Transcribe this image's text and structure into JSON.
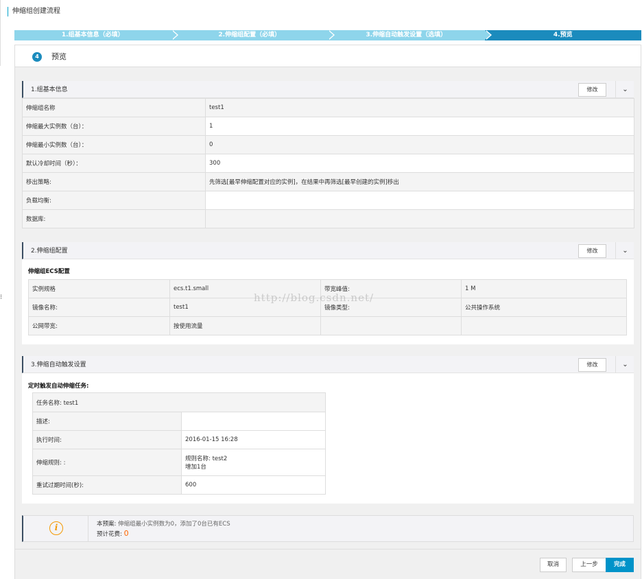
{
  "page": {
    "title": "伸缩组创建流程"
  },
  "steps": [
    "1.组基本信息（必填）",
    "2.伸缩组配置（必填）",
    "3.伸缩自动触发设置（选填）",
    "4.预览"
  ],
  "preview": {
    "number": "4",
    "title": "预览"
  },
  "section1": {
    "title": "1.组基本信息",
    "edit_label": "修改",
    "rows": [
      {
        "label": "伸缩组名称",
        "value": "test1"
      },
      {
        "label": "伸缩最大实例数（台）：",
        "value": "1"
      },
      {
        "label": "伸缩最小实例数（台）：",
        "value": "0"
      },
      {
        "label": "默认冷却时间（秒）：",
        "value": "300"
      },
      {
        "label": "移出策略:",
        "value": "先筛选[最早伸缩配置对应的实例]，在结果中再筛选[最早创建的实例]移出"
      },
      {
        "label": "负载均衡:",
        "value": ""
      },
      {
        "label": "数据库:",
        "value": ""
      }
    ]
  },
  "section2": {
    "title": "2.伸缩组配置",
    "edit_label": "修改",
    "subtitle": "伸缩组ECS配置",
    "rows": [
      [
        "实例规格",
        "ecs.t1.small",
        "带宽峰值:",
        "1 M"
      ],
      [
        "镜像名称:",
        "test1",
        "镜像类型:",
        "公共操作系统"
      ],
      [
        "公网带宽:",
        "按使用流量",
        "",
        ""
      ]
    ]
  },
  "section3": {
    "title": "3.伸缩自动触发设置",
    "edit_label": "修改",
    "subtitle": "定时触发自动伸缩任务:",
    "task_name": "任务名称:  test1",
    "rows": [
      {
        "label": "描述:",
        "value": ""
      },
      {
        "label": "执行时间:",
        "value": "2016-01-15 16:28"
      },
      {
        "label": "伸缩规则: :",
        "value_line1": "规则名称:  test2",
        "value_line2": "增加1台"
      },
      {
        "label": "重试过期时间(秒):",
        "value": "600"
      }
    ]
  },
  "notice": {
    "icon": "info-icon",
    "label": "本预案:",
    "text": "伸缩组最小实例数为0，添加了0台已有ECS",
    "cost_label": "预计花费:",
    "cost_value": "0"
  },
  "footer": {
    "cancel": "取消",
    "prev": "上一步",
    "finish": "完成"
  },
  "watermark": "http://blog.csdn.net/",
  "colors": {
    "accent": "#1b8bbd",
    "step_inactive": "#8ed5eb",
    "primary_button": "#0093c9",
    "warning": "#f39800"
  }
}
